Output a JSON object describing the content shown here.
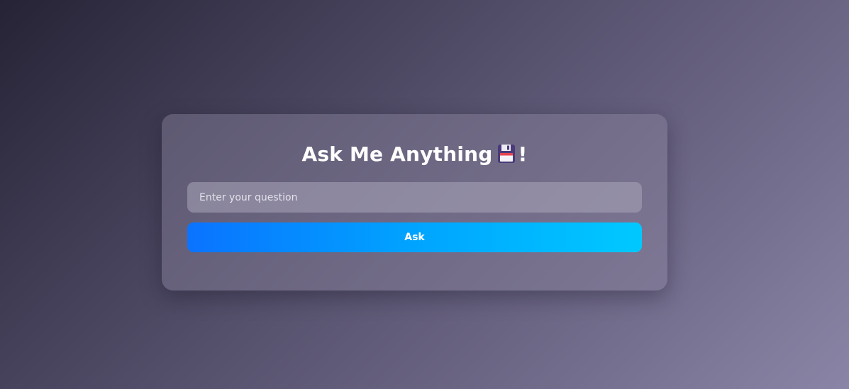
{
  "card": {
    "title_text": "Ask Me Anything",
    "title_icon": "floppy-disk-icon",
    "title_suffix": "!"
  },
  "question_input": {
    "placeholder": "Enter your question",
    "value": ""
  },
  "ask_button": {
    "label": "Ask"
  },
  "colors": {
    "button_gradient_start": "#0a73ff",
    "button_gradient_end": "#00c9ff",
    "text": "#ffffff"
  }
}
